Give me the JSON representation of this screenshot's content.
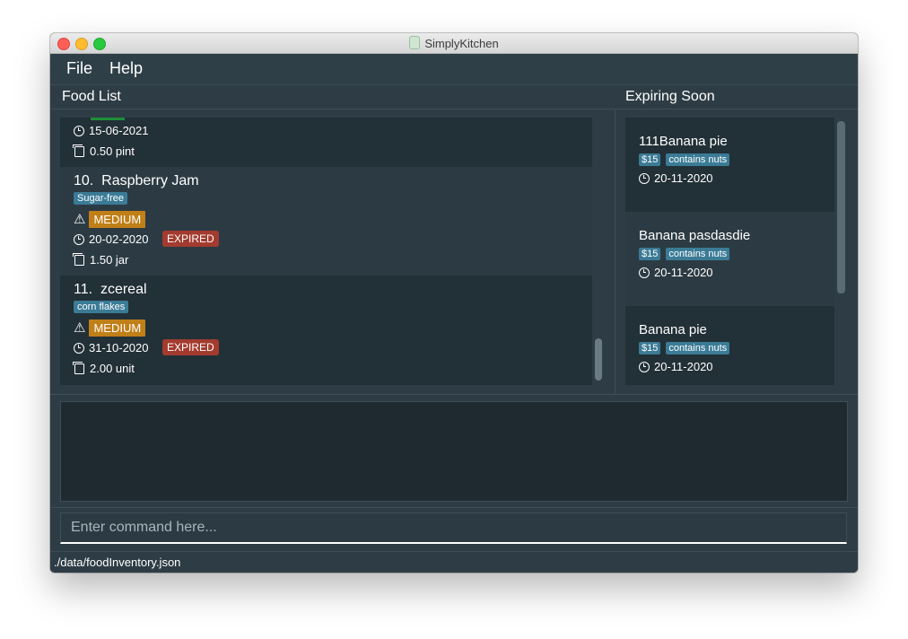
{
  "window": {
    "title": "SimplyKitchen"
  },
  "menu": {
    "file": "File",
    "help": "Help"
  },
  "panels": {
    "food_list": "Food List",
    "expiring_soon": "Expiring Soon"
  },
  "food_list": {
    "partial": {
      "date": "15-06-2021",
      "quantity": "0.50 pint"
    },
    "items": [
      {
        "index": "10.",
        "name": "Raspberry Jam",
        "tag": "Sugar-free",
        "priority": "MEDIUM",
        "date": "20-02-2020",
        "status": "EXPIRED",
        "quantity": "1.50 jar"
      },
      {
        "index": "11.",
        "name": "zcereal",
        "tag": "corn flakes",
        "priority": "MEDIUM",
        "date": "31-10-2020",
        "status": "EXPIRED",
        "quantity": "2.00 unit"
      }
    ]
  },
  "expiring_soon": [
    {
      "name": "111Banana pie",
      "tags": [
        "$15",
        "contains nuts"
      ],
      "date": "20-11-2020"
    },
    {
      "name": "Banana pasdasdie",
      "tags": [
        "$15",
        "contains nuts"
      ],
      "date": "20-11-2020"
    },
    {
      "name": "Banana pie",
      "tags": [
        "$15",
        "contains nuts"
      ],
      "date": "20-11-2020"
    }
  ],
  "command": {
    "placeholder": "Enter command here...",
    "value": ""
  },
  "status_bar": {
    "path": "./data/foodInventory.json"
  },
  "colors": {
    "tag": "#3b7b96",
    "priority_medium": "#c17f18",
    "expired": "#a33b2f",
    "window_bg": "#2e3d45"
  }
}
